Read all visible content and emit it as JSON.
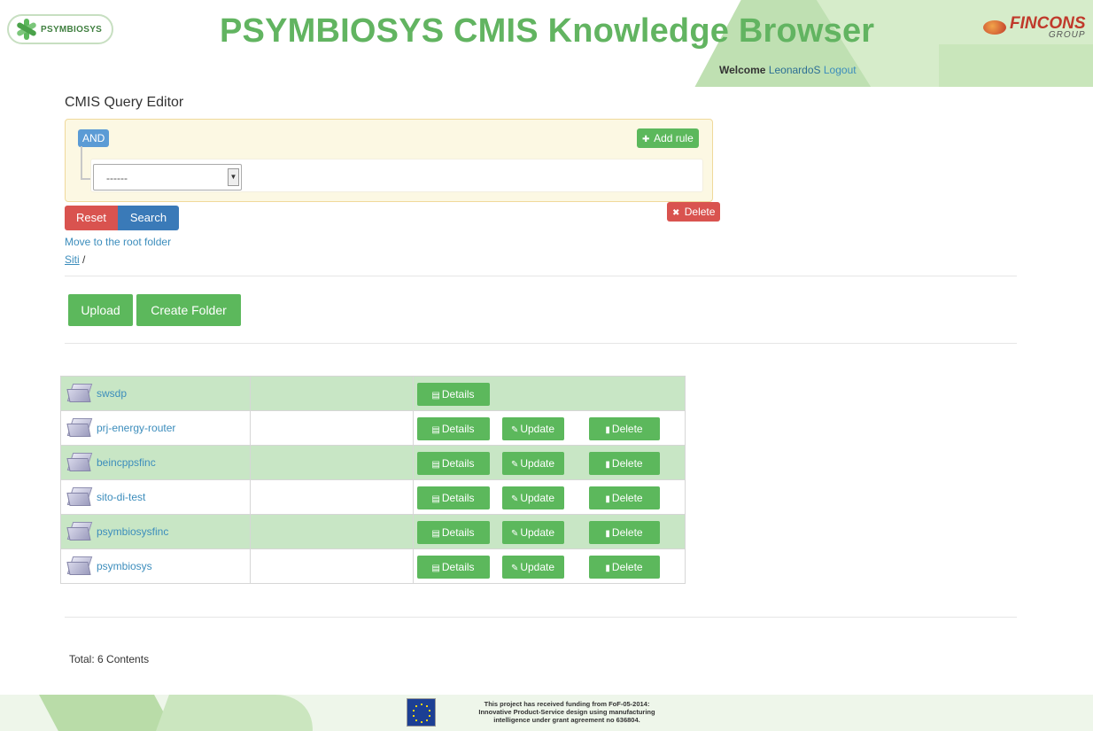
{
  "header": {
    "logo_text": "PSYMBIOSYS",
    "title": "PSYMBIOSYS CMIS Knowledge Browser",
    "partner_logo_name": "FINCONS",
    "partner_logo_sub": "GROUP",
    "welcome_label": "Welcome",
    "user_name": "LeonardoS",
    "logout_label": "Logout"
  },
  "query_editor": {
    "title": "CMIS Query Editor",
    "condition_label": "AND",
    "add_rule_label": "Add rule",
    "delete_rule_label": "Delete",
    "field_select_value": "------",
    "reset_label": "Reset",
    "search_label": "Search"
  },
  "navigation": {
    "move_root_label": "Move to the root folder",
    "breadcrumb_item": "Siti",
    "breadcrumb_separator": "/"
  },
  "toolbar": {
    "upload_label": "Upload",
    "create_folder_label": "Create Folder"
  },
  "action_labels": {
    "details": "Details",
    "update": "Update",
    "delete": "Delete"
  },
  "folders": [
    {
      "name": "swsdp",
      "has_update": false
    },
    {
      "name": "prj-energy-router",
      "has_update": true
    },
    {
      "name": "beincppsfinc",
      "has_update": true
    },
    {
      "name": "sito-di-test",
      "has_update": true
    },
    {
      "name": "psymbiosysfinc",
      "has_update": true
    },
    {
      "name": "psymbiosys",
      "has_update": true
    }
  ],
  "summary": {
    "total_label": "Total:",
    "total_value": "6 Contents"
  },
  "footer": {
    "funding_line1": "This project has received funding from FoF-05-2014:",
    "funding_line2": "Innovative Product-Service design using manufacturing",
    "funding_line3": "intelligence under grant agreement no 636804."
  },
  "colors": {
    "brand_green": "#5cb85c",
    "title_green": "#62b461",
    "danger_red": "#d9534f",
    "primary_blue": "#3a7ab8",
    "link_blue": "#3c8dbc",
    "row_highlight": "#c8e6c5"
  }
}
